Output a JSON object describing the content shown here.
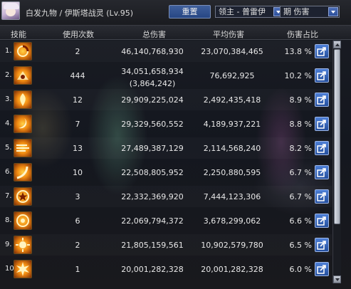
{
  "header": {
    "character_name": "白发九物 / 伊斯塔战灵 (Lv.95)",
    "reset_label": "重置",
    "target_select": "领主 - 普雷伊",
    "metric_select": "期 伤害"
  },
  "columns": {
    "skill": "技能",
    "uses": "使用次数",
    "total": "总伤害",
    "avg": "平均伤害",
    "pct": "伤害占比"
  },
  "rows": [
    {
      "rank": "1.",
      "uses": "2",
      "total": "46,140,768,930",
      "avg": "23,070,384,465",
      "pct": "13.8 %",
      "icon": "fire-swirl-icon"
    },
    {
      "rank": "2.",
      "uses": "444",
      "total": "34,051,658,934",
      "total_sub": "(3,864,242)",
      "avg": "76,692,925",
      "pct": "10.2 %",
      "icon": "fire-spark-icon"
    },
    {
      "rank": "3.",
      "uses": "12",
      "total": "29,909,225,024",
      "avg": "2,492,435,418",
      "pct": "8.9 %",
      "icon": "flame-burst-icon"
    },
    {
      "rank": "4.",
      "uses": "7",
      "total": "29,329,560,552",
      "avg": "4,189,937,221",
      "pct": "8.8 %",
      "icon": "moon-slash-icon"
    },
    {
      "rank": "5.",
      "uses": "13",
      "total": "27,489,387,129",
      "avg": "2,114,568,240",
      "pct": "8.2 %",
      "icon": "speed-dash-icon"
    },
    {
      "rank": "6.",
      "uses": "10",
      "total": "22,508,805,952",
      "avg": "2,250,880,595",
      "pct": "6.7 %",
      "icon": "crescent-wave-icon"
    },
    {
      "rank": "7.",
      "uses": "3",
      "total": "22,332,369,920",
      "avg": "7,444,123,306",
      "pct": "6.7 %",
      "icon": "star-ring-icon"
    },
    {
      "rank": "8.",
      "uses": "6",
      "total": "22,069,794,372",
      "avg": "3,678,299,062",
      "pct": "6.6 %",
      "icon": "target-orbit-icon"
    },
    {
      "rank": "9.",
      "uses": "2",
      "total": "21,805,159,561",
      "avg": "10,902,579,780",
      "pct": "6.5 %",
      "icon": "sun-flare-icon"
    },
    {
      "rank": "10.",
      "uses": "1",
      "total": "20,001,282,328",
      "avg": "20,001,282,328",
      "pct": "6.0 %",
      "icon": "explosion-icon"
    }
  ],
  "colors": {
    "button_blue": "#2c4f9a",
    "icon_orange": "#f08a12"
  }
}
